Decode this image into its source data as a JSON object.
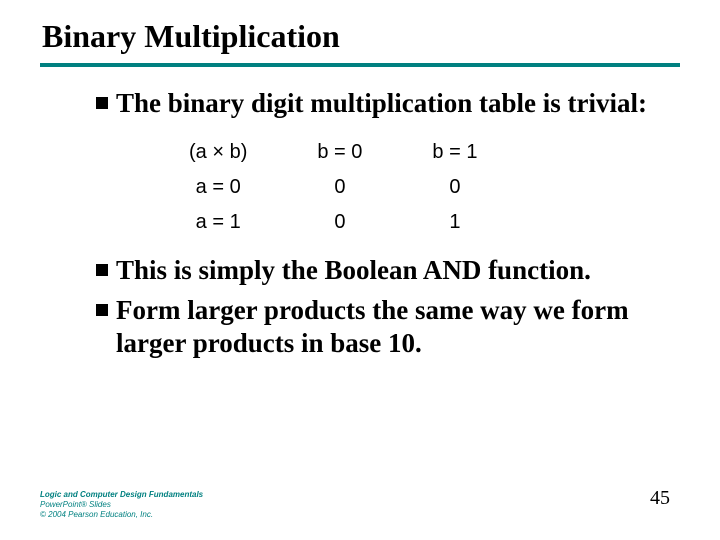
{
  "title": "Binary Multiplication",
  "bullets": [
    "The binary digit multiplication table is trivial:",
    "This is simply the Boolean AND function.",
    "Form larger products the same way we form larger products in base 10."
  ],
  "table": {
    "header": [
      "(a × b)",
      "b = 0",
      "b = 1"
    ],
    "rows": [
      [
        "a = 0",
        "0",
        "0"
      ],
      [
        "a = 1",
        "0",
        "1"
      ]
    ]
  },
  "footer": {
    "line1": "Logic and Computer Design Fundamentals",
    "line2": "PowerPoint® Slides",
    "line3": "© 2004 Pearson Education, Inc."
  },
  "page_number": "45",
  "chart_data": {
    "type": "table",
    "title": "Binary digit multiplication (a × b)",
    "columns": [
      "b = 0",
      "b = 1"
    ],
    "rows": [
      "a = 0",
      "a = 1"
    ],
    "values": [
      [
        0,
        0
      ],
      [
        0,
        1
      ]
    ]
  }
}
